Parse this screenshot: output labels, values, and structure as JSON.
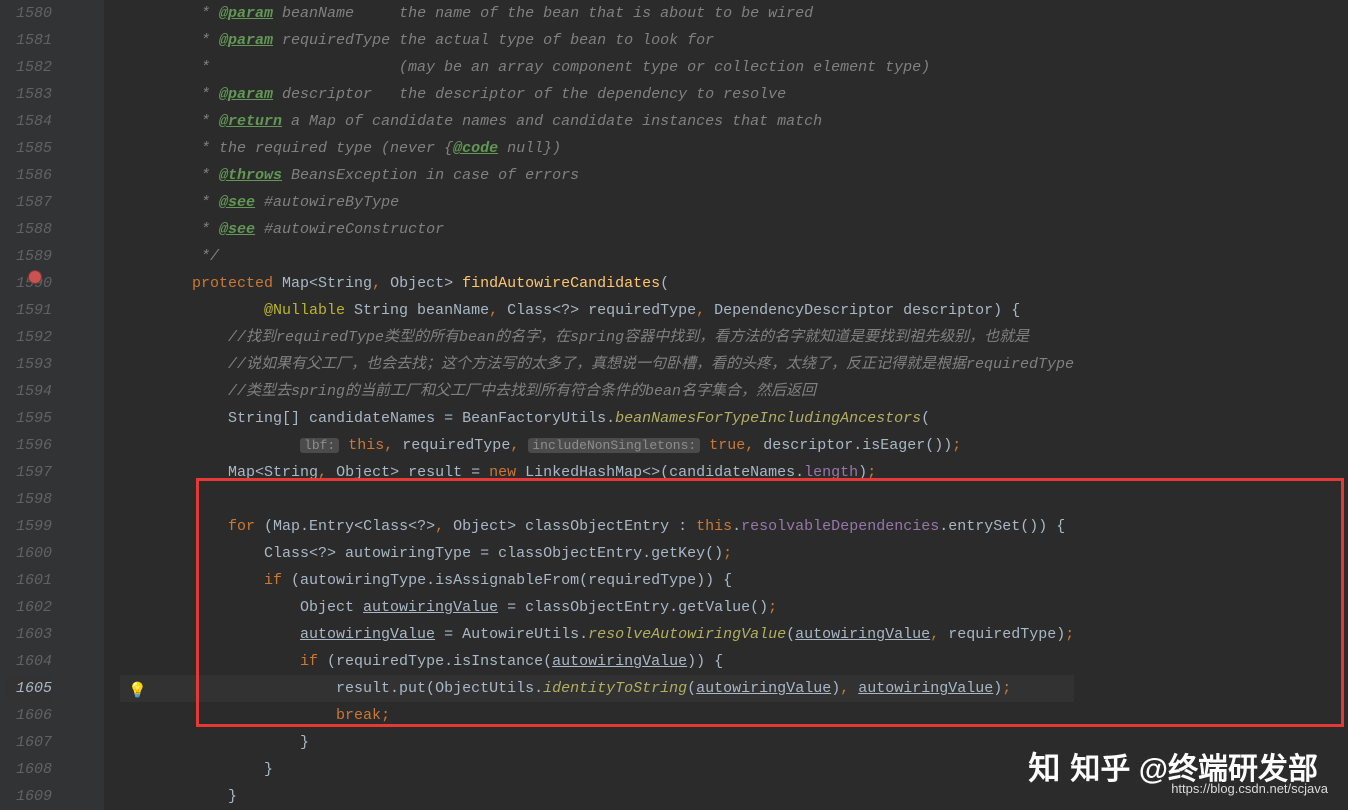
{
  "gutter": {
    "start": 1580,
    "end": 1609,
    "current": 1605
  },
  "lines": {
    "1580": [
      {
        "ws": "        "
      },
      {
        "c": "comment",
        "t": " * "
      },
      {
        "c": "doctag",
        "t": "@param"
      },
      {
        "c": "comment",
        "t": " beanName     the name of the bean that is about to be wired"
      }
    ],
    "1581": [
      {
        "ws": "        "
      },
      {
        "c": "comment",
        "t": " * "
      },
      {
        "c": "doctag",
        "t": "@param"
      },
      {
        "c": "comment",
        "t": " requiredType the actual type of bean to look for"
      }
    ],
    "1582": [
      {
        "ws": "        "
      },
      {
        "c": "comment",
        "t": " *                     (may be an array component type or collection element type)"
      }
    ],
    "1583": [
      {
        "ws": "        "
      },
      {
        "c": "comment",
        "t": " * "
      },
      {
        "c": "doctag",
        "t": "@param"
      },
      {
        "c": "comment",
        "t": " descriptor   the descriptor of the dependency to resolve"
      }
    ],
    "1584": [
      {
        "ws": "        "
      },
      {
        "c": "comment",
        "t": " * "
      },
      {
        "c": "doctag",
        "t": "@return"
      },
      {
        "c": "comment",
        "t": " a Map of candidate names and candidate instances that match"
      }
    ],
    "1585": [
      {
        "ws": "        "
      },
      {
        "c": "comment",
        "t": " * the required type (never {"
      },
      {
        "c": "doctag",
        "t": "@code"
      },
      {
        "c": "comment",
        "t": " null})"
      }
    ],
    "1586": [
      {
        "ws": "        "
      },
      {
        "c": "comment",
        "t": " * "
      },
      {
        "c": "doctag",
        "t": "@throws"
      },
      {
        "c": "comment",
        "t": " BeansException in case of errors"
      }
    ],
    "1587": [
      {
        "ws": "        "
      },
      {
        "c": "comment",
        "t": " * "
      },
      {
        "c": "doctag",
        "t": "@see"
      },
      {
        "c": "comment",
        "t": " #autowireByType"
      }
    ],
    "1588": [
      {
        "ws": "        "
      },
      {
        "c": "comment",
        "t": " * "
      },
      {
        "c": "doctag",
        "t": "@see"
      },
      {
        "c": "comment",
        "t": " #autowireConstructor"
      }
    ],
    "1589": [
      {
        "ws": "        "
      },
      {
        "c": "comment",
        "t": " */"
      }
    ],
    "1590": [
      {
        "ws": "        "
      },
      {
        "c": "keyword",
        "t": "protected"
      },
      {
        "t": " Map<String"
      },
      {
        "c": "punc",
        "t": ", "
      },
      {
        "t": "Object> "
      },
      {
        "c": "method-decl",
        "t": "findAutowireCandidates"
      },
      {
        "t": "("
      }
    ],
    "1591": [
      {
        "ws": "                "
      },
      {
        "c": "anno",
        "t": "@Nullable"
      },
      {
        "t": " String beanName"
      },
      {
        "c": "punc",
        "t": ", "
      },
      {
        "t": "Class<?> requiredType"
      },
      {
        "c": "punc",
        "t": ", "
      },
      {
        "t": "DependencyDescriptor descriptor) {"
      }
    ],
    "1592": [
      {
        "ws": "            "
      },
      {
        "c": "comment",
        "t": "//找到requiredType类型的所有bean的名字，在spring容器中找到，看方法的名字就知道是要找到祖先级别，也就是"
      }
    ],
    "1593": [
      {
        "ws": "            "
      },
      {
        "c": "comment",
        "t": "//说如果有父工厂，也会去找；这个方法写的太多了，真想说一句卧槽，看的头疼，太绕了，反正记得就是根据requiredType"
      }
    ],
    "1594": [
      {
        "ws": "            "
      },
      {
        "c": "comment",
        "t": "//类型去spring的当前工厂和父工厂中去找到所有符合条件的bean名字集合，然后返回"
      }
    ],
    "1595": [
      {
        "ws": "            "
      },
      {
        "t": "String[] candidateNames = BeanFactoryUtils."
      },
      {
        "c": "static-method",
        "t": "beanNamesForTypeIncludingAncestors"
      },
      {
        "t": "("
      }
    ],
    "1596": [
      {
        "ws": "                    "
      },
      {
        "c": "param-hint",
        "t": "lbf:"
      },
      {
        "t": " "
      },
      {
        "c": "keyword",
        "t": "this"
      },
      {
        "c": "punc",
        "t": ", "
      },
      {
        "t": "requiredType"
      },
      {
        "c": "punc",
        "t": ", "
      },
      {
        "c": "param-hint",
        "t": "includeNonSingletons:"
      },
      {
        "t": " "
      },
      {
        "c": "keyword",
        "t": "true"
      },
      {
        "c": "punc",
        "t": ", "
      },
      {
        "t": "descriptor.isEager())"
      },
      {
        "c": "punc",
        "t": ";"
      }
    ],
    "1597": [
      {
        "ws": "            "
      },
      {
        "t": "Map<String"
      },
      {
        "c": "punc",
        "t": ", "
      },
      {
        "t": "Object> result = "
      },
      {
        "c": "keyword",
        "t": "new"
      },
      {
        "t": " LinkedHashMap<>(candidateNames."
      },
      {
        "c": "field",
        "t": "length"
      },
      {
        "t": ")"
      },
      {
        "c": "punc",
        "t": ";"
      }
    ],
    "1598": [
      {
        "t": ""
      }
    ],
    "1599": [
      {
        "ws": "            "
      },
      {
        "c": "keyword",
        "t": "for"
      },
      {
        "t": " (Map.Entry<Class<?>"
      },
      {
        "c": "punc",
        "t": ", "
      },
      {
        "t": "Object> classObjectEntry : "
      },
      {
        "c": "keyword",
        "t": "this"
      },
      {
        "t": "."
      },
      {
        "c": "field",
        "t": "resolvableDependencies"
      },
      {
        "t": ".entrySet()) {"
      }
    ],
    "1600": [
      {
        "ws": "                "
      },
      {
        "t": "Class<?> autowiringType = classObjectEntry.getKey()"
      },
      {
        "c": "punc",
        "t": ";"
      }
    ],
    "1601": [
      {
        "ws": "                "
      },
      {
        "c": "keyword",
        "t": "if"
      },
      {
        "t": " (autowiringType.isAssignableFrom(requiredType)) {"
      }
    ],
    "1602": [
      {
        "ws": "                    "
      },
      {
        "t": "Object "
      },
      {
        "c": "under",
        "t": "autowiringValue"
      },
      {
        "t": " = classObjectEntry.getValue()"
      },
      {
        "c": "punc",
        "t": ";"
      }
    ],
    "1603": [
      {
        "ws": "                    "
      },
      {
        "c": "under",
        "t": "autowiringValue"
      },
      {
        "t": " = AutowireUtils."
      },
      {
        "c": "static-method",
        "t": "resolveAutowiringValue"
      },
      {
        "t": "("
      },
      {
        "c": "under",
        "t": "autowiringValue"
      },
      {
        "c": "punc",
        "t": ", "
      },
      {
        "t": "requiredType)"
      },
      {
        "c": "punc",
        "t": ";"
      }
    ],
    "1604": [
      {
        "ws": "                    "
      },
      {
        "c": "keyword",
        "t": "if"
      },
      {
        "t": " (requiredType.isInstance("
      },
      {
        "c": "under",
        "t": "autowiringValue"
      },
      {
        "t": ")) {"
      }
    ],
    "1605": [
      {
        "ws": "                        "
      },
      {
        "t": "result.put("
      },
      {
        "c": "type",
        "t": "ObjectUtils"
      },
      {
        "t": "."
      },
      {
        "c": "static-method",
        "t": "identityToString"
      },
      {
        "t": "("
      },
      {
        "c": "under",
        "t": "autowiringValue"
      },
      {
        "t": ")"
      },
      {
        "c": "punc",
        "t": ", "
      },
      {
        "c": "under",
        "t": "autowiringValue"
      },
      {
        "t": ")"
      },
      {
        "c": "punc",
        "t": ";"
      }
    ],
    "1606": [
      {
        "ws": "                        "
      },
      {
        "c": "keyword",
        "t": "break"
      },
      {
        "c": "punc",
        "t": ";"
      }
    ],
    "1607": [
      {
        "ws": "                    "
      },
      {
        "t": "}"
      }
    ],
    "1608": [
      {
        "ws": "                "
      },
      {
        "t": "}"
      }
    ],
    "1609": [
      {
        "ws": "            "
      },
      {
        "t": "}"
      }
    ]
  },
  "watermark": {
    "label": "知乎 @终端研发部",
    "url": "https://blog.csdn.net/scjava"
  }
}
